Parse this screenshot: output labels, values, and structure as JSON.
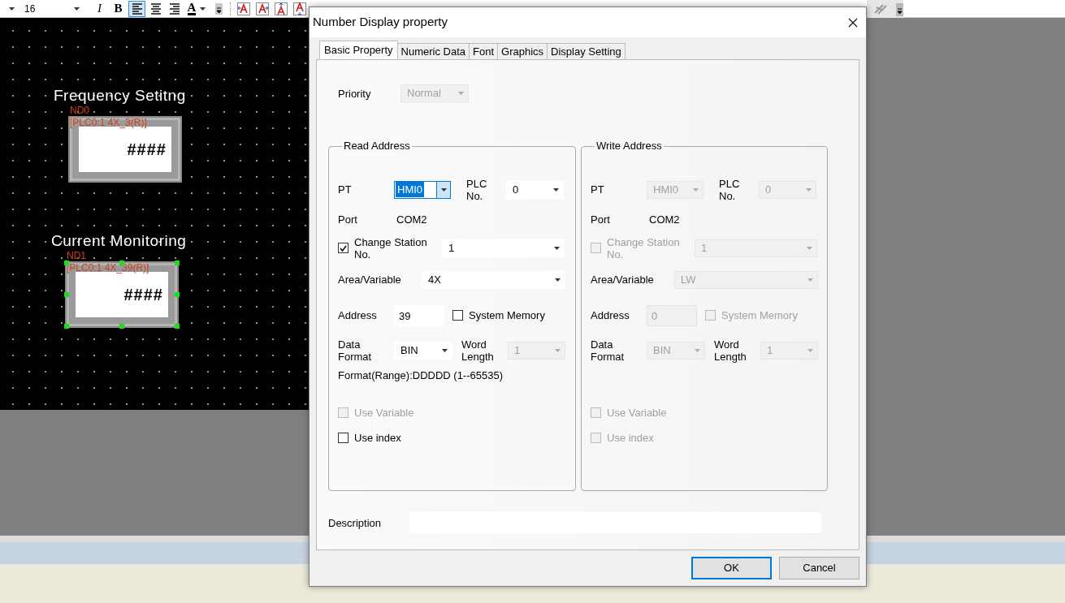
{
  "toolbar": {
    "font_size": "16",
    "items": [
      {
        "kind": "italic",
        "label": "I",
        "selected": false
      },
      {
        "kind": "bold",
        "label": "B",
        "selected": false
      },
      {
        "kind": "align-left",
        "selected": true
      },
      {
        "kind": "align-center",
        "selected": false
      },
      {
        "kind": "align-right",
        "selected": false
      },
      {
        "kind": "font-color",
        "label": "A",
        "selected": false
      }
    ]
  },
  "canvas": {
    "objects": [
      {
        "title": "Frequency Setitng",
        "name": "ND0",
        "address": "[PLC0:1 4X_3(R)]",
        "value": "####",
        "selected": false
      },
      {
        "title": "Current Monitoring",
        "name": "ND1",
        "address": "[PLC0:1 4X_39(R)]",
        "value": "####",
        "selected": true
      }
    ]
  },
  "dialog": {
    "title": "Number Display property",
    "tabs": [
      {
        "label": "Basic Property",
        "selected": true
      },
      {
        "label": "Numeric Data",
        "selected": false
      },
      {
        "label": "Font",
        "selected": false
      },
      {
        "label": "Graphics",
        "selected": false
      },
      {
        "label": "Display Setting",
        "selected": false
      }
    ],
    "priority": {
      "label": "Priority",
      "value": "Normal",
      "disabled": true
    },
    "groups": [
      {
        "legend": "Read Address",
        "pt": {
          "label": "PT",
          "value": "HMI0",
          "disabled": false,
          "focused": true
        },
        "plc_no": {
          "label": "PLC No.",
          "value": "0",
          "disabled": false
        },
        "port": {
          "label": "Port",
          "value": "COM2"
        },
        "change_station": {
          "label": "Change Station No.",
          "checked": true,
          "disabled": false,
          "value": "1"
        },
        "area": {
          "label": "Area/Variable",
          "value": "4X",
          "disabled": false
        },
        "address": {
          "label": "Address",
          "value": "39",
          "disabled": false
        },
        "system_memory": {
          "label": "System Memory",
          "checked": false,
          "disabled": false
        },
        "data_format": {
          "label": "Data Format",
          "value": "BIN",
          "disabled": false
        },
        "word_length": {
          "label": "Word Length",
          "value": "1",
          "disabled": true
        },
        "format_range": "Format(Range):DDDDD (1--65535)",
        "use_variable": {
          "label": "Use Variable",
          "checked": false,
          "disabled": true
        },
        "use_index": {
          "label": "Use index",
          "checked": false,
          "disabled": false
        }
      },
      {
        "legend": "Write Address",
        "pt": {
          "label": "PT",
          "value": "HMI0",
          "disabled": true,
          "focused": false
        },
        "plc_no": {
          "label": "PLC No.",
          "value": "0",
          "disabled": true
        },
        "port": {
          "label": "Port",
          "value": "COM2"
        },
        "change_station": {
          "label": "Change Station No.",
          "checked": false,
          "disabled": true,
          "value": "1"
        },
        "area": {
          "label": "Area/Variable",
          "value": "LW",
          "disabled": true
        },
        "address": {
          "label": "Address",
          "value": "0",
          "disabled": true
        },
        "system_memory": {
          "label": "System Memory",
          "checked": false,
          "disabled": true
        },
        "data_format": {
          "label": "Data Format",
          "value": "BIN",
          "disabled": true
        },
        "word_length": {
          "label": "Word Length",
          "value": "1",
          "disabled": true
        },
        "use_variable": {
          "label": "Use Variable",
          "checked": false,
          "disabled": true
        },
        "use_index": {
          "label": "Use index",
          "checked": false,
          "disabled": true
        }
      }
    ],
    "description": {
      "label": "Description"
    },
    "buttons": [
      {
        "label": "OK",
        "default": true
      },
      {
        "label": "Cancel",
        "default": false
      }
    ]
  }
}
